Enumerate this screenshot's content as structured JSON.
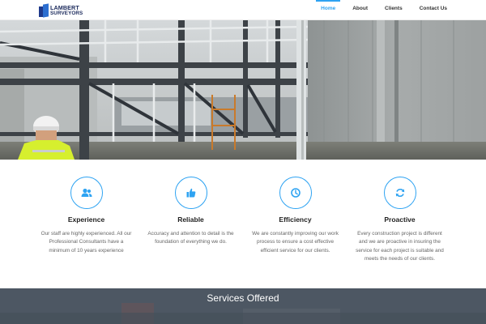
{
  "brand": {
    "name_line1": "LAMBERT",
    "name_line2": "SURVEYORS",
    "colors": {
      "dark": "#1f3a8c",
      "light": "#2d6fd0"
    }
  },
  "nav": {
    "items": [
      {
        "label": "Home",
        "active": true
      },
      {
        "label": "About"
      },
      {
        "label": "Clients"
      },
      {
        "label": "Contact Us"
      }
    ],
    "accent": "#2ea3f2"
  },
  "hero": {
    "icon": "construction-site-photo"
  },
  "features": [
    {
      "icon": "users-icon",
      "title": "Experience",
      "text": "Our staff are highly experienced. All our Professional Consultants have a minimum of 10 years experience"
    },
    {
      "icon": "thumbs-up-icon",
      "title": "Reliable",
      "text": "Accuracy and attention to detail is the foundation of everything we do."
    },
    {
      "icon": "clock-icon",
      "title": "Efficiency",
      "text": "We are constantly improving our work process to ensure a cost effective efficient service for our clients."
    },
    {
      "icon": "refresh-icon",
      "title": "Proactive",
      "text": "Every construction project is different and we are proactive in insuring the service for each project is suitable and meets the needs of our clients."
    }
  ],
  "services": {
    "title": "Services Offered"
  }
}
